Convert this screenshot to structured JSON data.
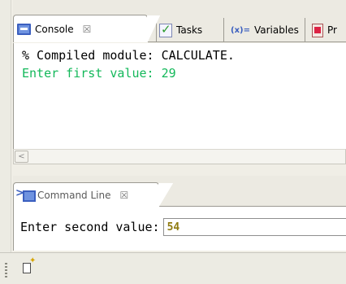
{
  "console_tabs": [
    {
      "label": "Console",
      "icon": "console-icon",
      "close": "☒",
      "active": true
    },
    {
      "label": "Tasks",
      "icon": "tasks-icon",
      "active": false
    },
    {
      "label": "Variables",
      "icon_text": "(x)=",
      "icon": "variables-icon",
      "active": false
    },
    {
      "label": "Pr",
      "icon": "problems-icon",
      "active": false
    }
  ],
  "console": {
    "output_line": "% Compiled module: CALCULATE.",
    "input_line": "Enter first value: 29",
    "colors": {
      "output": "#000000",
      "input": "#13b85a"
    }
  },
  "command_line": {
    "tab_label": "Command Line",
    "tab_close": "☒",
    "prompt": "Enter second value:",
    "value": "54",
    "value_color": "#8f7b10"
  },
  "scrollbar": {
    "left_arrow": "<"
  }
}
